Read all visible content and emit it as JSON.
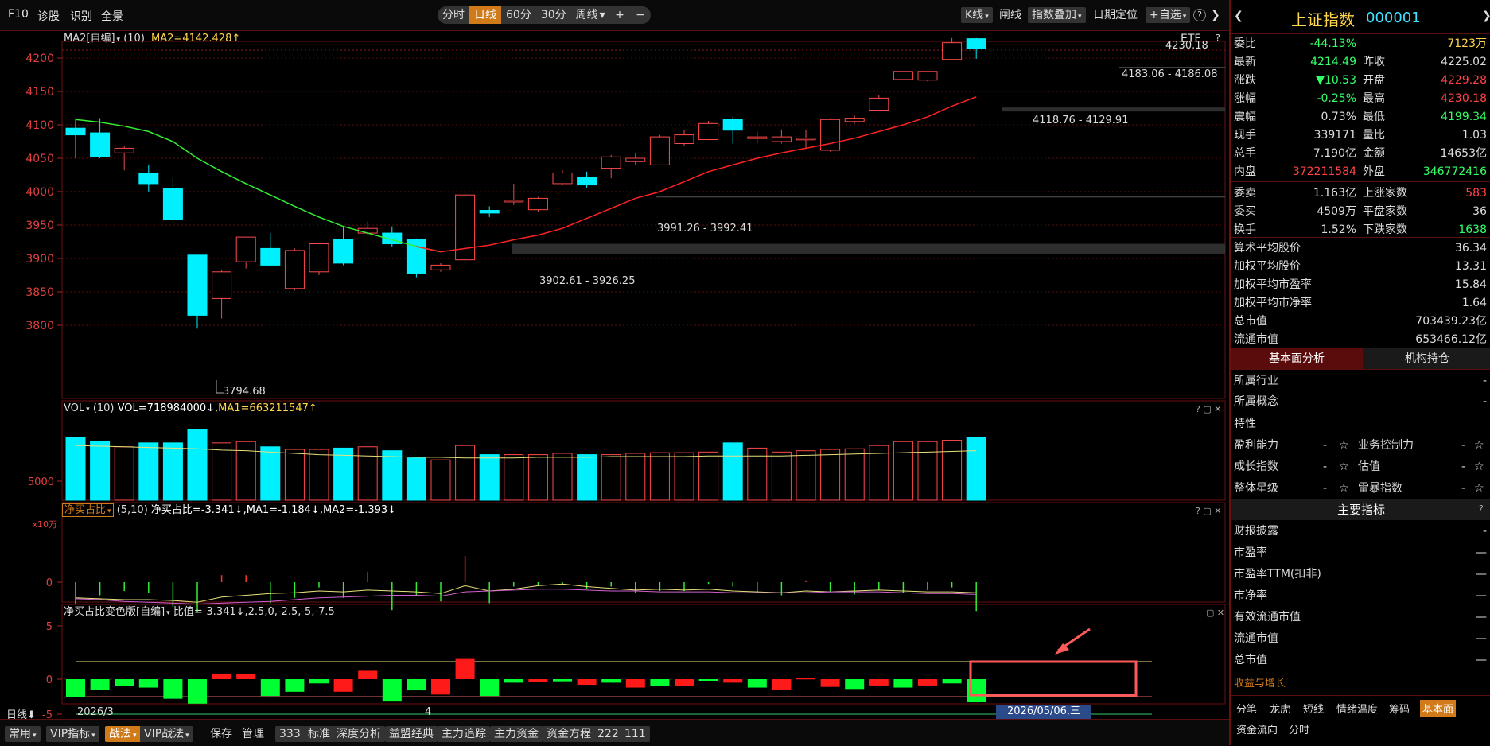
{
  "topbar": {
    "f10": "F10",
    "diag": "诊股",
    "recog": "识别",
    "full": "全景",
    "periods": [
      "分时",
      "日线",
      "60分",
      "30分",
      "周线"
    ],
    "active_period": "日线",
    "plus": "+",
    "minus": "−",
    "kline": "K线",
    "linechart": "闸线",
    "overlay": "指数叠加",
    "datepos": "日期定位",
    "addfav": "+自选",
    "help": "?"
  },
  "main_chart": {
    "indicator": "MA2[自编]",
    "param": "(10)",
    "value_text": "MA2=4142.428↑",
    "etf": "ETF",
    "ylabels": [
      "4200",
      "4150",
      "4100",
      "4050",
      "4000",
      "3950",
      "3900",
      "3850",
      "3800"
    ],
    "annotations": [
      "4230.18",
      "4183.06 - 4186.08",
      "4118.76 - 4129.91",
      "3991.26 - 3992.41",
      "3902.61 - 3926.25",
      "3794.68"
    ]
  },
  "vol_panel": {
    "title": "VOL",
    "param": "(10)",
    "vol_text": "VOL=718984000↓",
    "ma_text": ",MA1=663211547↑",
    "ylabel": "5000",
    "unit": "x10万"
  },
  "net_panel": {
    "title": "净买占比",
    "param": "(5,10)",
    "value_text": "净买占比=-3.341↓,MA1=-1.184↓,MA2=-1.393↓",
    "ylabels": [
      "0",
      "-5"
    ]
  },
  "color_panel": {
    "title": "净买占比变色版[自编]",
    "value_text": "比值=-3.341↓,2.5,0,-2.5,-5,-7.5",
    "ylabels": [
      "0",
      "-5"
    ]
  },
  "xaxis": {
    "period": "日线",
    "date1": "2026/3",
    "date2": "4",
    "cursor_date": "2026/05/06,三"
  },
  "bottombar": {
    "items": [
      "常用",
      "VIP指标",
      "战法",
      "VIP战法",
      "保存",
      "管理",
      "333",
      "标准",
      "深度分析",
      "益盟经典",
      "主力追踪",
      "主力资金",
      "资金方程",
      "222",
      "111"
    ]
  },
  "right_panel": {
    "name": "上证指数",
    "code": "000001",
    "rows": [
      {
        "k": "委比",
        "v": "-44.13%",
        "k2": "",
        "v2": "7123万"
      },
      {
        "k": "最新",
        "v": "4214.49",
        "k2": "昨收",
        "v2": "4225.02"
      },
      {
        "k": "涨跌",
        "v": "▼10.53",
        "k2": "开盘",
        "v2": "4229.28"
      },
      {
        "k": "涨幅",
        "v": "-0.25%",
        "k2": "最高",
        "v2": "4230.18"
      },
      {
        "k": "震幅",
        "v": "0.73%",
        "k2": "最低",
        "v2": "4199.34"
      },
      {
        "k": "现手",
        "v": "339171",
        "k2": "量比",
        "v2": "1.03"
      },
      {
        "k": "总手",
        "v": "7.190亿",
        "k2": "金额",
        "v2": "14653亿"
      },
      {
        "k": "内盘",
        "v": "372211584",
        "k2": "外盘",
        "v2": "346772416"
      },
      {
        "k": "委卖",
        "v": "1.163亿",
        "k2": "上涨家数",
        "v2": "583"
      },
      {
        "k": "委买",
        "v": "4509万",
        "k2": "平盘家数",
        "v2": "36"
      },
      {
        "k": "换手",
        "v": "1.52%",
        "k2": "下跌家数",
        "v2": "1638"
      }
    ],
    "rows2": [
      {
        "k": "算术平均股价",
        "v": "36.34"
      },
      {
        "k": "加权平均股价",
        "v": "13.31"
      },
      {
        "k": "加权平均市盈率",
        "v": "15.84"
      },
      {
        "k": "加权平均市净率",
        "v": "1.64"
      },
      {
        "k": "总市值",
        "v": "703439.23亿"
      },
      {
        "k": "流通市值",
        "v": "653466.12亿"
      }
    ],
    "tab1": "基本面分析",
    "tab2": "机构持仓",
    "industry": "所属行业",
    "concept": "所属概念",
    "feature": "特性",
    "dash": "-",
    "ratings": [
      {
        "k": "盈利能力",
        "v": "-",
        "k2": "业务控制力",
        "v2": "-"
      },
      {
        "k": "成长指数",
        "v": "-",
        "k2": "估值",
        "v2": "-"
      },
      {
        "k": "整体星级",
        "v": "-",
        "k2": "雷暴指数",
        "v2": "-"
      }
    ],
    "main_title": "主要指标",
    "indicators": [
      "财报披露",
      "市盈率",
      "市盈率TTM(扣非)",
      "市净率",
      "有效流通市值",
      "流通市值",
      "总市值"
    ],
    "indicator_value": "—",
    "growth": "收益与增长",
    "bottom_tabs": [
      "分笔",
      "龙虎",
      "短线",
      "情绪温度",
      "筹码",
      "基本面",
      "资金流向",
      "分时"
    ],
    "active_tab": "基本面"
  },
  "colors": {
    "up": "#ff3333",
    "down": "#00e5ff",
    "bg": "#000000",
    "accent": "#d07a1a"
  }
}
